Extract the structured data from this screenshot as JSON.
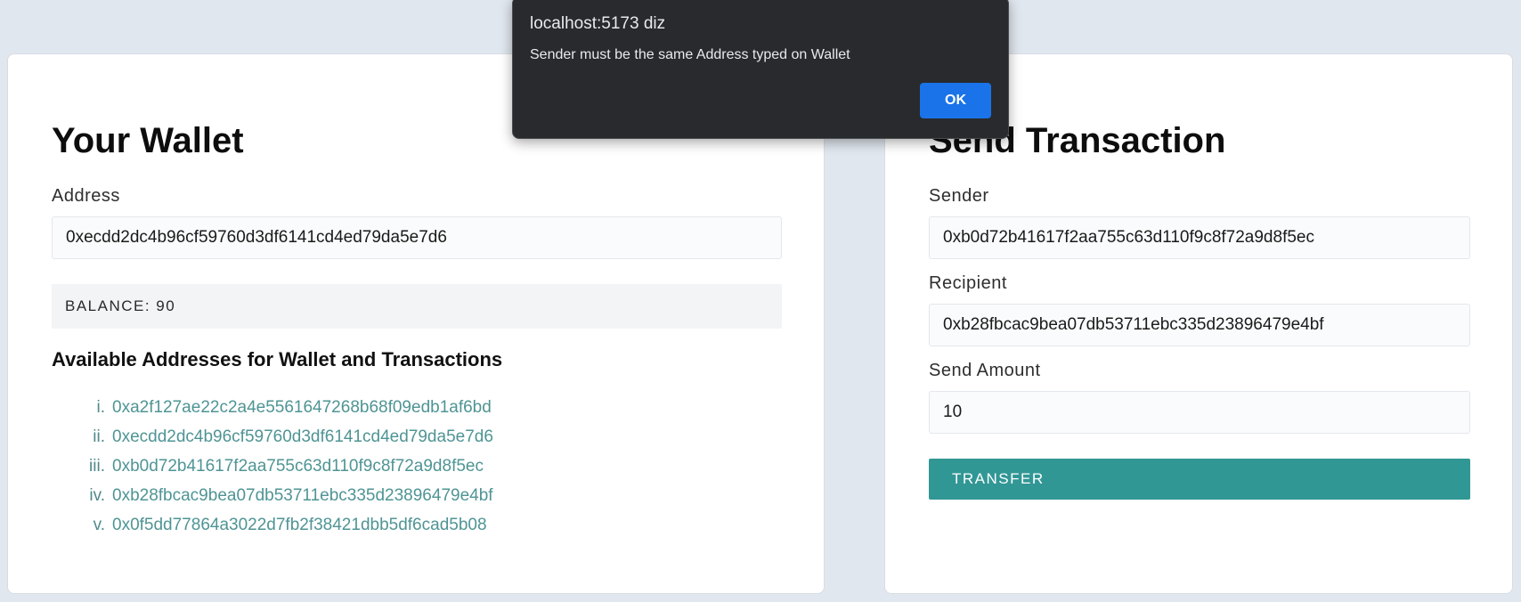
{
  "wallet": {
    "title": "Your Wallet",
    "address_label": "Address",
    "address_value": "0xecdd2dc4b96cf59760d3df6141cd4ed79da5e7d6",
    "balance_text": "BALANCE: 90",
    "addresses_title": "Available Addresses for Wallet and Transactions",
    "addresses": [
      {
        "num": "i.",
        "addr": "0xa2f127ae22c2a4e5561647268b68f09edb1af6bd"
      },
      {
        "num": "ii.",
        "addr": "0xecdd2dc4b96cf59760d3df6141cd4ed79da5e7d6"
      },
      {
        "num": "iii.",
        "addr": "0xb0d72b41617f2aa755c63d110f9c8f72a9d8f5ec"
      },
      {
        "num": "iv.",
        "addr": "0xb28fbcac9bea07db53711ebc335d23896479e4bf"
      },
      {
        "num": "v.",
        "addr": "0x0f5dd77864a3022d7fb2f38421dbb5df6cad5b08"
      }
    ]
  },
  "transaction": {
    "title": "Send Transaction",
    "sender_label": "Sender",
    "sender_value": "0xb0d72b41617f2aa755c63d110f9c8f72a9d8f5ec",
    "recipient_label": "Recipient",
    "recipient_value": "0xb28fbcac9bea07db53711ebc335d23896479e4bf",
    "amount_label": "Send Amount",
    "amount_value": "10",
    "transfer_label": "TRANSFER"
  },
  "dialog": {
    "title": "localhost:5173 diz",
    "message": "Sender must be the same Address typed on Wallet",
    "ok_label": "OK"
  },
  "colors": {
    "page_bg": "#e1e7ef",
    "accent": "#319795",
    "link": "#4f9494",
    "dialog_bg": "#292a2d",
    "dialog_button": "#1a73e8"
  }
}
